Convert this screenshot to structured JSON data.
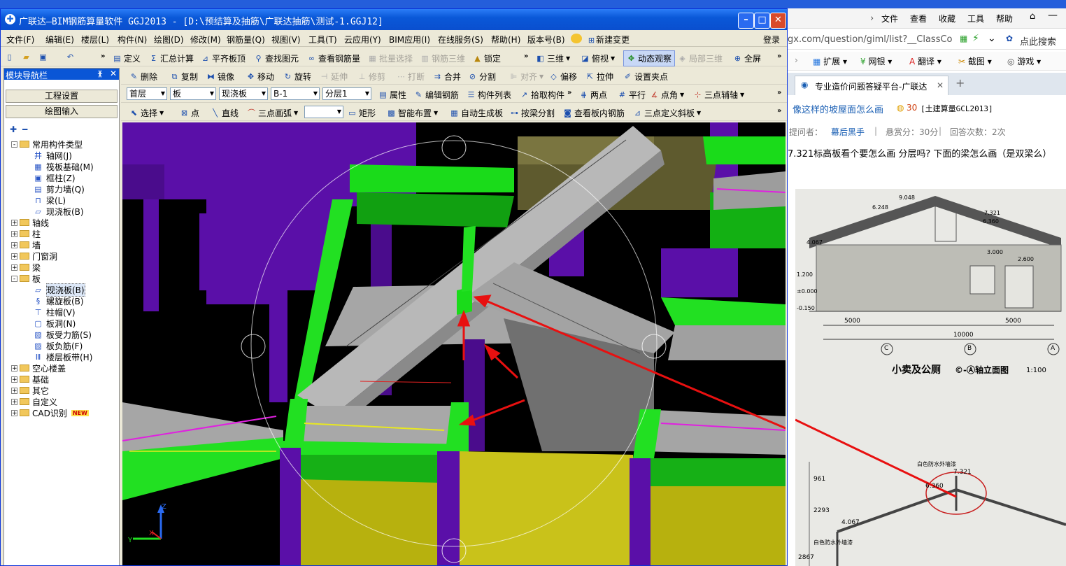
{
  "window": {
    "title": "广联达—BIM钢筋算量软件 GGJ2013 - [D:\\预结算及抽筋\\广联达抽筋\\测试-1.GGJ12]",
    "min_glyph": "–",
    "max_glyph": "□",
    "close_glyph": "✕"
  },
  "menu": [
    "文件(F)",
    "编辑(E)",
    "楼层(L)",
    "构件(N)",
    "绘图(D)",
    "修改(M)",
    "钢筋量(Q)",
    "视图(V)",
    "工具(T)",
    "云应用(Y)",
    "BIM应用(I)",
    "在线服务(S)",
    "帮助(H)",
    "版本号(B)"
  ],
  "menu_extra": {
    "new_change": "新建变更",
    "login": "登录"
  },
  "toolbar1": {
    "define": "定义",
    "sum": "汇总计算",
    "flush": "平齐板顶",
    "find": "查找图元",
    "view_rebar": "查看钢筋量",
    "batch": "批量选择",
    "rebar3d": "钢筋三维",
    "lock": "锁定",
    "three_d": "三维",
    "top_view": "俯视",
    "dynamic": "动态观察",
    "local3d": "局部三维",
    "fullscreen": "全屏"
  },
  "toolbar2": {
    "delete": "删除",
    "copy": "复制",
    "mirror": "镜像",
    "move": "移动",
    "rotate": "旋转",
    "extend": "延伸",
    "trim": "修剪",
    "break": "打断",
    "merge": "合并",
    "split": "分割",
    "align": "对齐",
    "offset": "偏移",
    "stretch": "拉伸",
    "set_grip": "设置夹点"
  },
  "toolbar3": {
    "floor": "首层",
    "category": "板",
    "type": "现浇板",
    "name": "B-1",
    "layer": "分层1",
    "props": "属性",
    "edit_rebar": "编辑钢筋",
    "comp_list": "构件列表",
    "pick": "拾取构件",
    "two_point": "两点",
    "parallel": "平行",
    "point_angle": "点角",
    "three_axis": "三点辅轴"
  },
  "toolbar4": {
    "select": "选择",
    "point": "点",
    "line": "直线",
    "arc": "三点画弧",
    "rect": "矩形",
    "smart": "智能布置",
    "auto_gen": "自动生成板",
    "beam_split": "按梁分割",
    "view_inner": "查看板内钢筋",
    "three_slope": "三点定义斜板"
  },
  "nav": {
    "title": "模块导航栏",
    "pin": "ᚕ",
    "close": "✕",
    "project_settings": "工程设置",
    "draw_input": "绘图输入",
    "tree": [
      {
        "type": "folder",
        "exp": "-",
        "label": "常用构件类型"
      },
      {
        "type": "item",
        "icon": "井",
        "label": "轴网(J)"
      },
      {
        "type": "item",
        "icon": "▦",
        "label": "筏板基础(M)"
      },
      {
        "type": "item",
        "icon": "▣",
        "label": "框柱(Z)"
      },
      {
        "type": "item",
        "icon": "▤",
        "label": "剪力墙(Q)"
      },
      {
        "type": "item",
        "icon": "⊓",
        "label": "梁(L)"
      },
      {
        "type": "item",
        "icon": "▱",
        "label": "现浇板(B)"
      },
      {
        "type": "folder",
        "exp": "+",
        "label": "轴线"
      },
      {
        "type": "folder",
        "exp": "+",
        "label": "柱"
      },
      {
        "type": "folder",
        "exp": "+",
        "label": "墙"
      },
      {
        "type": "folder",
        "exp": "+",
        "label": "门窗洞"
      },
      {
        "type": "folder",
        "exp": "+",
        "label": "梁"
      },
      {
        "type": "folder",
        "exp": "-",
        "label": "板"
      },
      {
        "type": "item",
        "icon": "▱",
        "label": "现浇板(B)",
        "selected": true
      },
      {
        "type": "item",
        "icon": "§",
        "label": "螺旋板(B)"
      },
      {
        "type": "item",
        "icon": "⊤",
        "label": "柱帽(V)"
      },
      {
        "type": "item",
        "icon": "▢",
        "label": "板洞(N)"
      },
      {
        "type": "item",
        "icon": "▧",
        "label": "板受力筋(S)"
      },
      {
        "type": "item",
        "icon": "▨",
        "label": "板负筋(F)"
      },
      {
        "type": "item",
        "icon": "Ⅲ",
        "label": "楼层板带(H)"
      },
      {
        "type": "folder",
        "exp": "+",
        "label": "空心楼盖"
      },
      {
        "type": "folder",
        "exp": "+",
        "label": "基础"
      },
      {
        "type": "folder",
        "exp": "+",
        "label": "其它"
      },
      {
        "type": "folder",
        "exp": "+",
        "label": "自定义"
      },
      {
        "type": "folder",
        "exp": "+",
        "label": "CAD识别",
        "badge": "NEW"
      }
    ]
  },
  "axes": {
    "x": "X",
    "y": "Y",
    "z": "Z"
  },
  "browser": {
    "menu": [
      "文件",
      "查看",
      "收藏",
      "工具",
      "帮助"
    ],
    "address": "gx.com/question/giml/list?__ClassCo",
    "search_placeholder": "点此搜索",
    "favs": [
      "扩展",
      "网银",
      "翻译",
      "截图",
      "游戏"
    ],
    "tab_title": "专业造价问题答疑平台-广联达",
    "tab_close": "✕",
    "new_tab": "+",
    "question_title": "像这样的坡屋面怎么画",
    "points": "30",
    "category": "[土建算量GCL2013]",
    "asker_label": "提问者：",
    "asker": "幕后黑手",
    "reward": "悬赏分：30分",
    "answers": "回答次数：2次",
    "body": "7.321标高板看个要怎么画 分层吗?    下面的梁怎么画（是双梁么）",
    "drawing": {
      "elev1": "9.048",
      "elev2": "6.248",
      "elev3": "7.321",
      "elev4": "6.360",
      "elev5": "4.067",
      "elev6": "±0.000",
      "elev7": "-0.150",
      "dims": [
        "1.200",
        "5000",
        "5000",
        "10000",
        "3.000",
        "2.600"
      ],
      "axes": [
        "C",
        "B",
        "A"
      ],
      "title": "小卖及公厕",
      "axis_note": "©-Ⓐ轴立面图",
      "scale": "1:100",
      "lower_note": "白色防水外墙漆",
      "lower_elev1": "7.321",
      "lower_elev2": "6.360",
      "lower_elev3": "4.067",
      "lower_dims": [
        "961",
        "2293",
        "2867"
      ],
      "lower_note2": "白色防水外墙漆"
    }
  }
}
